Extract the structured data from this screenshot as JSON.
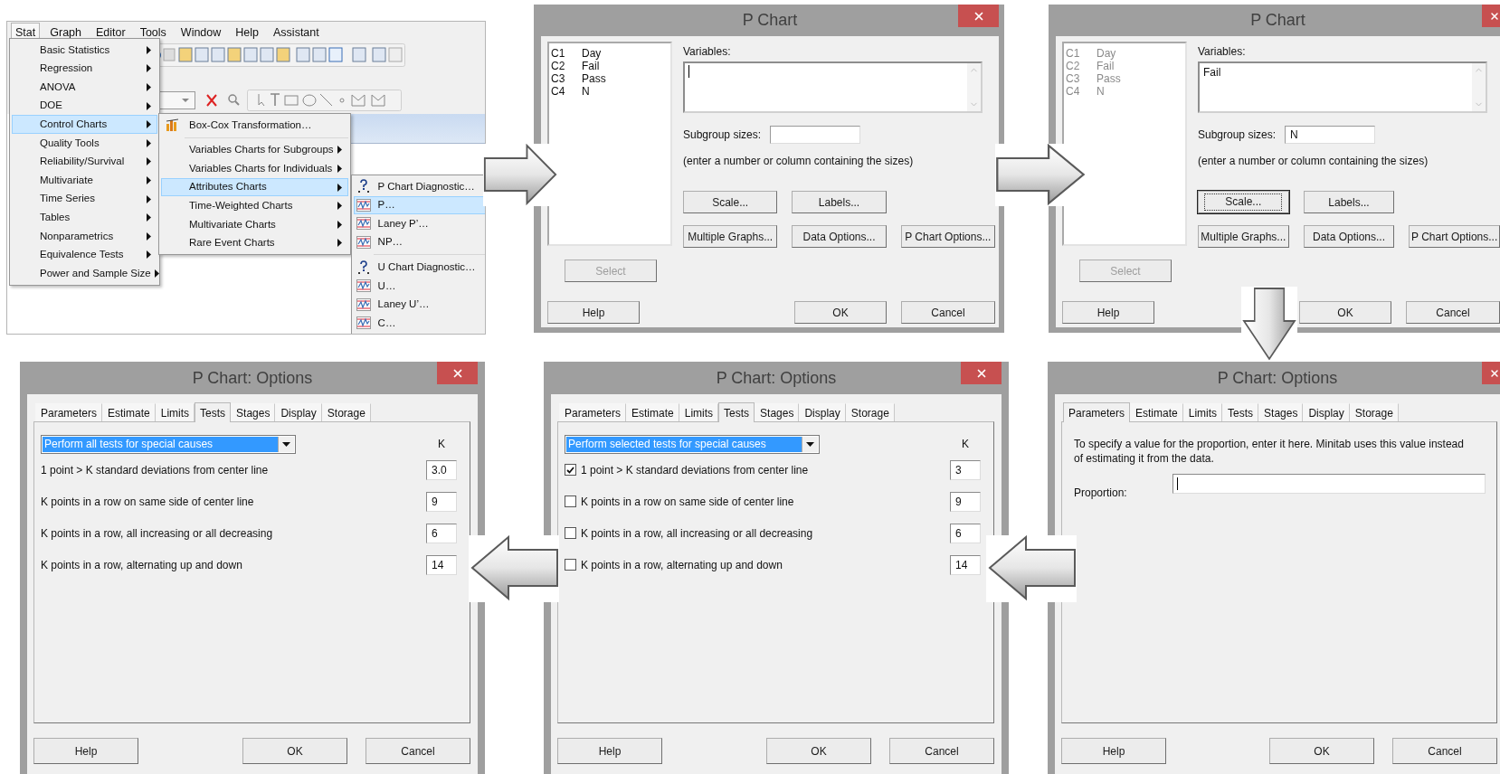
{
  "menu_screenshot": {
    "menubar": [
      {
        "label": "Stat",
        "selected": true
      },
      {
        "label": "Graph",
        "selected": false
      },
      {
        "label": "Editor",
        "selected": false
      },
      {
        "label": "Tools",
        "selected": false
      },
      {
        "label": "Window",
        "selected": false
      },
      {
        "label": "Help",
        "selected": false
      },
      {
        "label": "Assistant",
        "selected": false
      }
    ],
    "stat_menu": {
      "groups": [
        [
          {
            "label": "Basic Statistics",
            "selected": false,
            "has_submenu": true
          },
          {
            "label": "Regression",
            "selected": false,
            "has_submenu": true
          },
          {
            "label": "ANOVA",
            "selected": false,
            "has_submenu": true
          },
          {
            "label": "DOE",
            "selected": false,
            "has_submenu": true
          },
          {
            "label": "Control Charts",
            "selected": true,
            "has_submenu": true
          },
          {
            "label": "Quality Tools",
            "selected": false,
            "has_submenu": true
          },
          {
            "label": "Reliability/Survival",
            "selected": false,
            "has_submenu": true
          },
          {
            "label": "Multivariate",
            "selected": false,
            "has_submenu": true
          },
          {
            "label": "Time Series",
            "selected": false,
            "has_submenu": true
          },
          {
            "label": "Tables",
            "selected": false,
            "has_submenu": true
          },
          {
            "label": "Nonparametrics",
            "selected": false,
            "has_submenu": true
          },
          {
            "label": "Equivalence Tests",
            "selected": false,
            "has_submenu": true
          },
          {
            "label": "Power and Sample Size",
            "selected": false,
            "has_submenu": true
          }
        ]
      ]
    },
    "control_charts_menu": {
      "groups": [
        [
          {
            "label": "Box-Cox Transformation…",
            "selected": false,
            "kind": "boxcox",
            "has_submenu": false
          }
        ],
        [
          {
            "label": "Variables Charts for Subgroups",
            "selected": false,
            "kind": "plain",
            "has_submenu": true
          },
          {
            "label": "Variables Charts for Individuals",
            "selected": false,
            "kind": "plain",
            "has_submenu": true
          },
          {
            "label": "Attributes Charts",
            "selected": true,
            "kind": "plain",
            "has_submenu": true
          },
          {
            "label": "Time-Weighted Charts",
            "selected": false,
            "kind": "plain",
            "has_submenu": true
          },
          {
            "label": "Multivariate Charts",
            "selected": false,
            "kind": "plain",
            "has_submenu": true
          },
          {
            "label": "Rare Event Charts",
            "selected": false,
            "kind": "plain",
            "has_submenu": true
          }
        ]
      ]
    },
    "attributes_charts_menu": {
      "groups": [
        [
          {
            "label": "P Chart Diagnostic…",
            "selected": false,
            "kind": "diagnostic"
          },
          {
            "label": "P…",
            "selected": true,
            "kind": "chart"
          },
          {
            "label": "Laney P’…",
            "selected": false,
            "kind": "chart"
          },
          {
            "label": "NP…",
            "selected": false,
            "kind": "chart"
          }
        ],
        [
          {
            "label": "U Chart Diagnostic…",
            "selected": false,
            "kind": "diagnostic"
          },
          {
            "label": "U…",
            "selected": false,
            "kind": "chart"
          },
          {
            "label": "Laney U’…",
            "selected": false,
            "kind": "chart"
          },
          {
            "label": "C…",
            "selected": false,
            "kind": "chart"
          }
        ]
      ]
    }
  },
  "p_chart_dialogs": [
    {
      "title": "P Chart",
      "columns": [
        {
          "id": "C1",
          "name": "Day"
        },
        {
          "id": "C2",
          "name": "Fail"
        },
        {
          "id": "C3",
          "name": "Pass"
        },
        {
          "id": "C4",
          "name": "N"
        }
      ],
      "columns_disabled": false,
      "variables_label": "Variables:",
      "variables_focused": true,
      "subgroup_label": "Subgroup sizes:",
      "hint": "(enter a number or column containing the sizes)",
      "option_buttons": [
        {
          "label": "Scale...",
          "focused": false
        },
        {
          "label": "Labels...",
          "focused": false
        },
        {
          "label": "Multiple Graphs...",
          "focused": false
        },
        {
          "label": "Data Options...",
          "focused": false
        },
        {
          "label": "P Chart Options...",
          "focused": false
        }
      ],
      "select_button": {
        "label": "Select",
        "disabled": true
      },
      "help_button": "Help",
      "ok_button": "OK",
      "cancel_button": "Cancel"
    },
    {
      "title": "P Chart",
      "columns": [
        {
          "id": "C1",
          "name": "Day"
        },
        {
          "id": "C2",
          "name": "Fail"
        },
        {
          "id": "C3",
          "name": "Pass"
        },
        {
          "id": "C4",
          "name": "N"
        }
      ],
      "columns_disabled": true,
      "variables_label": "Variables:",
      "variables_value": "Fail",
      "variables_focused": false,
      "subgroup_label": "Subgroup sizes:",
      "subgroup_value": "N",
      "hint": "(enter a number or column containing the sizes)",
      "option_buttons": [
        {
          "label": "Scale...",
          "focused": true
        },
        {
          "label": "Labels...",
          "focused": false
        },
        {
          "label": "Multiple Graphs...",
          "focused": false
        },
        {
          "label": "Data Options...",
          "focused": false
        },
        {
          "label": "P Chart Options...",
          "focused": false
        }
      ],
      "select_button": {
        "label": "Select",
        "disabled": true
      },
      "help_button": "Help",
      "ok_button": "OK",
      "cancel_button": "Cancel"
    }
  ],
  "options_dialogs": [
    {
      "title": "P Chart: Options",
      "kind": "tests",
      "tabs": [
        {
          "label": "Parameters",
          "selected": false
        },
        {
          "label": "Estimate",
          "selected": false
        },
        {
          "label": "Limits",
          "selected": false
        },
        {
          "label": "Tests",
          "selected": true
        },
        {
          "label": "Stages",
          "selected": false
        },
        {
          "label": "Display",
          "selected": false
        },
        {
          "label": "Storage",
          "selected": false
        }
      ],
      "tests": {
        "mode": "Perform all tests for special causes",
        "k_header": "K",
        "rows": [
          {
            "kind": "plain",
            "label": "1 point > K standard deviations from center line",
            "k": "3.0"
          },
          {
            "kind": "plain",
            "label": "K points in a row on same side of center line",
            "k": "9"
          },
          {
            "kind": "plain",
            "label": "K points in a row, all increasing or all decreasing",
            "k": "6"
          },
          {
            "kind": "plain",
            "label": "K points in a row, alternating up and down",
            "k": "14"
          }
        ]
      },
      "help_button": "Help",
      "ok_button": "OK",
      "cancel_button": "Cancel"
    },
    {
      "title": "P Chart: Options",
      "kind": "tests",
      "tabs": [
        {
          "label": "Parameters",
          "selected": false
        },
        {
          "label": "Estimate",
          "selected": false
        },
        {
          "label": "Limits",
          "selected": false
        },
        {
          "label": "Tests",
          "selected": true
        },
        {
          "label": "Stages",
          "selected": false
        },
        {
          "label": "Display",
          "selected": false
        },
        {
          "label": "Storage",
          "selected": false
        }
      ],
      "tests": {
        "mode": "Perform selected tests for special causes",
        "k_header": "K",
        "rows": [
          {
            "kind": "checkbox",
            "checked": true,
            "label": "1 point > K standard deviations from center line",
            "k": "3"
          },
          {
            "kind": "checkbox",
            "checked": false,
            "label": "K points in a row on same side of center line",
            "k": "9"
          },
          {
            "kind": "checkbox",
            "checked": false,
            "label": "K points in a row, all increasing or all decreasing",
            "k": "6"
          },
          {
            "kind": "checkbox",
            "checked": false,
            "label": "K points in a row, alternating up and down",
            "k": "14"
          }
        ]
      },
      "help_button": "Help",
      "ok_button": "OK",
      "cancel_button": "Cancel"
    },
    {
      "title": "P Chart: Options",
      "kind": "parameters",
      "tabs": [
        {
          "label": "Parameters",
          "selected": true
        },
        {
          "label": "Estimate",
          "selected": false
        },
        {
          "label": "Limits",
          "selected": false
        },
        {
          "label": "Tests",
          "selected": false
        },
        {
          "label": "Stages",
          "selected": false
        },
        {
          "label": "Display",
          "selected": false
        },
        {
          "label": "Storage",
          "selected": false
        }
      ],
      "parameters": {
        "description": "To specify a value for the proportion, enter it here. Minitab uses this value instead of estimating it from the data.",
        "proportion_label": "Proportion:",
        "proportion_focused": true
      },
      "help_button": "Help",
      "ok_button": "OK",
      "cancel_button": "Cancel"
    }
  ]
}
